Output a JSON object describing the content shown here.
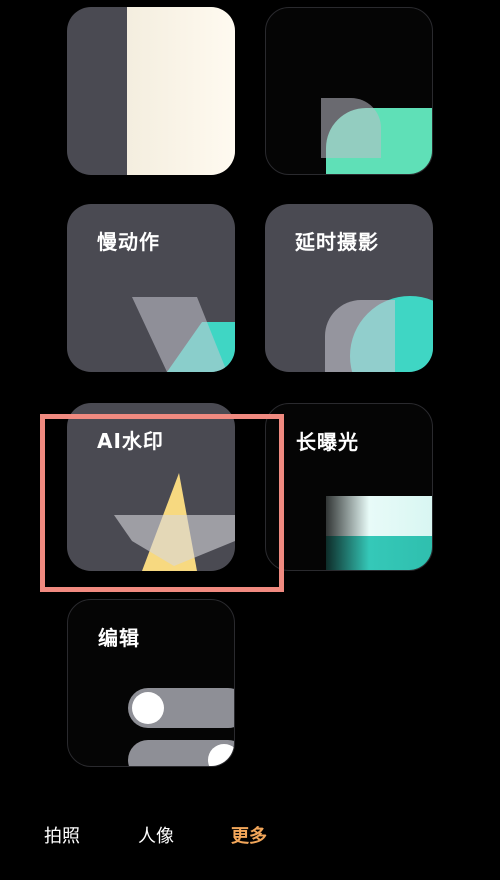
{
  "toolbar": {
    "grid_icon": "grid-icon",
    "edit_icon": "edit-icon"
  },
  "tiles": [
    {
      "label": "慢动作"
    },
    {
      "label": "延时摄影"
    },
    {
      "label": "AI水印"
    },
    {
      "label": "长曝光"
    },
    {
      "label": "编辑"
    }
  ],
  "tabs": [
    {
      "label": "拍照",
      "active": false
    },
    {
      "label": "人像",
      "active": false
    },
    {
      "label": "更多",
      "active": true
    }
  ],
  "colors": {
    "accent": "#f2a65a",
    "highlight": "#f08a80",
    "teal": "#3fd6c4",
    "star": "#f7d980"
  }
}
